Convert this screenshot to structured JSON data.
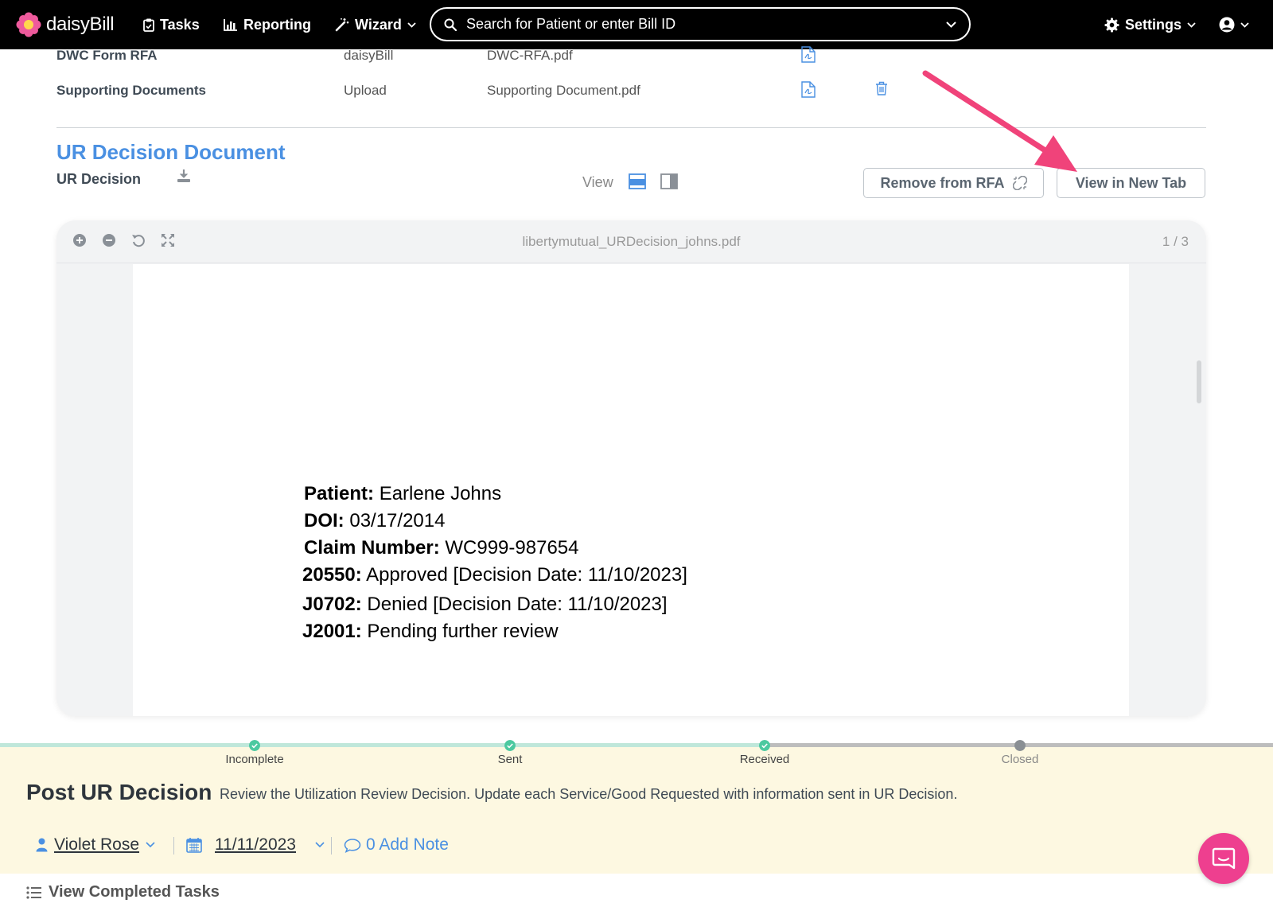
{
  "nav": {
    "brand": "daisyBill",
    "items": [
      {
        "label": "Tasks",
        "icon": "clipboard-icon"
      },
      {
        "label": "Reporting",
        "icon": "bar-chart-icon"
      },
      {
        "label": "Wizard",
        "icon": "magic-wand-icon"
      }
    ],
    "search_placeholder": "Search for Patient or enter Bill ID",
    "settings_label": "Settings"
  },
  "documents": [
    {
      "name": "DWC Form RFA",
      "source": "daisyBill",
      "file": "DWC-RFA.pdf"
    },
    {
      "name": "Supporting Documents",
      "source": "Upload",
      "file": "Supporting Document.pdf"
    }
  ],
  "ur_section": {
    "title": "UR Decision Document",
    "subtitle": "UR Decision",
    "view_label": "View",
    "remove_button": "Remove from RFA",
    "new_tab_button": "View in New Tab"
  },
  "viewer": {
    "filename": "libertymutual_URDecision_johns.pdf",
    "page_indicator": "1 / 3",
    "lines": [
      {
        "label": "Patient:",
        "value": "Earlene Johns"
      },
      {
        "label": "DOI:",
        "value": "03/17/2014"
      },
      {
        "label": "Claim Number:",
        "value": "WC999-987654"
      },
      {
        "label": "20550:",
        "value": "Approved [Decision Date: 11/10/2023]"
      },
      {
        "label": "J0702:",
        "value": "Denied [Decision Date: 11/10/2023]"
      },
      {
        "label": "J2001:",
        "value": "Pending further review"
      }
    ]
  },
  "progress": {
    "steps": [
      {
        "label": "Incomplete",
        "status": "complete"
      },
      {
        "label": "Sent",
        "status": "complete"
      },
      {
        "label": "Received",
        "status": "complete"
      },
      {
        "label": "Closed",
        "status": "pending"
      }
    ],
    "complete_color": "#4cc9a0",
    "pending_color": "#8a8f94"
  },
  "task": {
    "title": "Post UR Decision",
    "description": "Review the Utilization Review Decision. Update each Service/Good Requested with information sent in UR Decision.",
    "assignee": "Violet Rose",
    "date": "11/11/2023",
    "note_label": "0 Add Note",
    "completed_link": "View Completed Tasks"
  },
  "colors": {
    "accent": "#4a90e2",
    "annotation_arrow": "#f0437a",
    "chat_button": "#ee3f8f",
    "task_panel_bg": "#fdf8e1"
  }
}
